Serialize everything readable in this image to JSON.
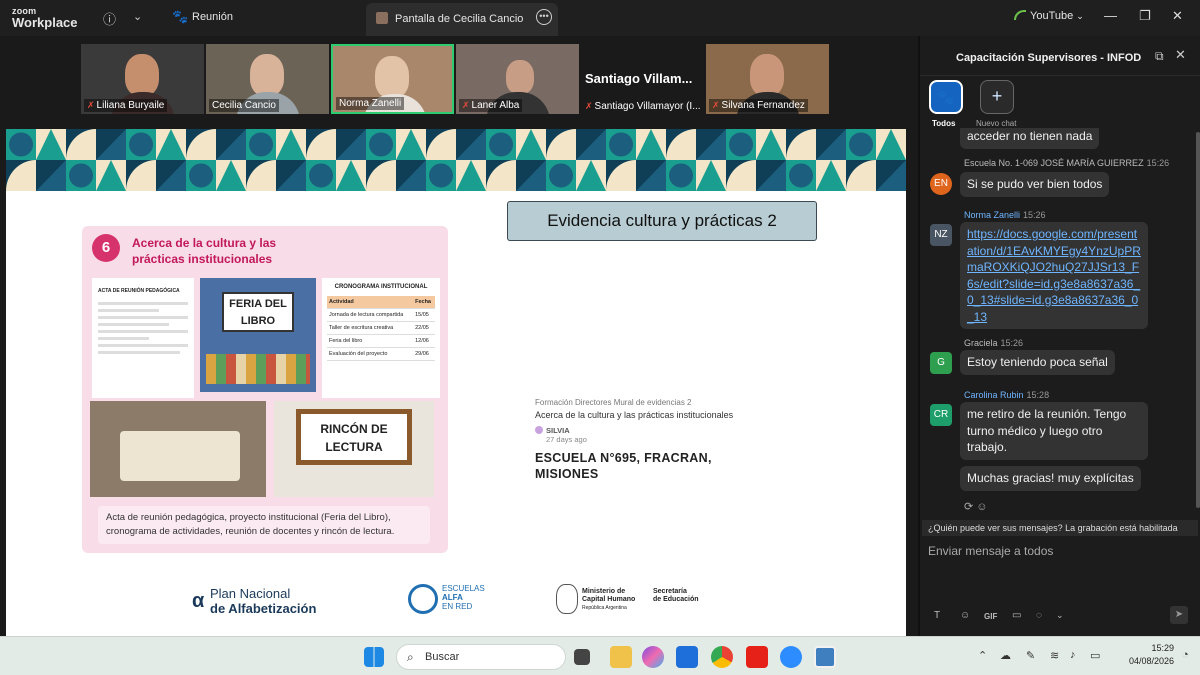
{
  "app": {
    "logo_line1": "zoom",
    "logo_line2": "Workplace",
    "meeting_label": "Reunión"
  },
  "share_tab": {
    "label": "Pantalla de Cecilia Cancio"
  },
  "youtube": {
    "label": "YouTube"
  },
  "participants": [
    {
      "name": "Liliana Buryaile",
      "muted": true
    },
    {
      "name": "Cecilia Cancio",
      "muted": false
    },
    {
      "name": "Norma Zanelli",
      "muted": false,
      "active": true
    },
    {
      "name": "Laner Alba",
      "muted": true
    },
    {
      "name": "Santiago Villamayor (I...",
      "muted": true,
      "display": "Santiago  Villam..."
    },
    {
      "name": "Silvana Fernandez",
      "muted": true
    }
  ],
  "slide": {
    "title": "Evidencia cultura y prácticas 2",
    "card_number": "6",
    "card_title": "Acerca de la cultura y las prácticas institucionales",
    "doc_header": "ACTA DE REUNIÓN PEDAGÓGICA",
    "feria_sign": "FERIA DEL LIBRO",
    "crono_header": "CRONOGRAMA INSTITUCIONAL",
    "crono_rows": [
      [
        "Actividad",
        "Fecha"
      ],
      [
        "Jornada de lectura compartida",
        "15/05"
      ],
      [
        "Taller de escritura creativa",
        "22/05"
      ],
      [
        "Feria del libro",
        "12/06"
      ],
      [
        "Evaluación del proyecto",
        "29/06"
      ]
    ],
    "rincon_sign": "RINCÓN DE LECTURA",
    "caption": "Acta de reunión pedagógica, proyecto institucional (Feria del Libro), cronograma de actividades, reunión de docentes y rincón de lectura.",
    "meta": "Formación Directores Mural de evidencias 2",
    "desc": "Acerca de la cultura y las prácticas institucionales",
    "user": "SILVIA",
    "ago": "27 days ago",
    "school": "ESCUELA N°695, FRACRAN, MISIONES",
    "footer": {
      "plan_line1": "Plan Nacional",
      "plan_line2": "de Alfabetización",
      "escuelas_l1": "ESCUELAS",
      "escuelas_l2": "ALFA",
      "escuelas_l3": "EN RED",
      "min_l1": "Ministerio de",
      "min_l2": "Capital Humano",
      "min_l3": "República Argentina",
      "sec_l1": "Secretaría",
      "sec_l2": "de Educación"
    }
  },
  "chat": {
    "title": "Capacitación Supervisores - INFOD",
    "nav": {
      "all": "Todos",
      "new": "Nuevo chat"
    },
    "messages": [
      {
        "text": "acceder no tienen nada"
      },
      {
        "sender": "Escuela No. 1-069 JOSÉ MARÍA GUIERREZ",
        "time": "15:26",
        "initials": "EN",
        "color": "#e0651c",
        "text": "Si se pudo ver bien todos"
      },
      {
        "sender": "Norma Zanelli",
        "time": "15:26",
        "initials": "NZ",
        "color": "#4a5563",
        "text": "https://docs.google.com/presentation/d/1EAvKMYEgy4YnzUpPRmaROXKiQJO2huQ27JJSr13_F6s/edit?slide=id.g3e8a8637a36_0_13#slide=id.g3e8a8637a36_0_13"
      },
      {
        "sender": "Graciela",
        "time": "15:26",
        "initials": "G",
        "color": "#2e9e4f",
        "text": "Estoy teniendo poca señal"
      },
      {
        "sender": "Carolina Rubin",
        "time": "15:28",
        "initials": "CR",
        "color": "#1e9e6a",
        "text": "me retiro de la reunión. Tengo turno médico y luego otro trabajo."
      },
      {
        "text": "Muchas gracias! muy explícitas"
      }
    ],
    "notice": "¿Quién puede ver sus mensajes? La grabación está habilitada",
    "placeholder": "Enviar mensaje a todos",
    "gif_label": "GIF"
  },
  "taskbar": {
    "search_label": "Buscar",
    "time": "15:29",
    "date": "04/08/2026"
  }
}
